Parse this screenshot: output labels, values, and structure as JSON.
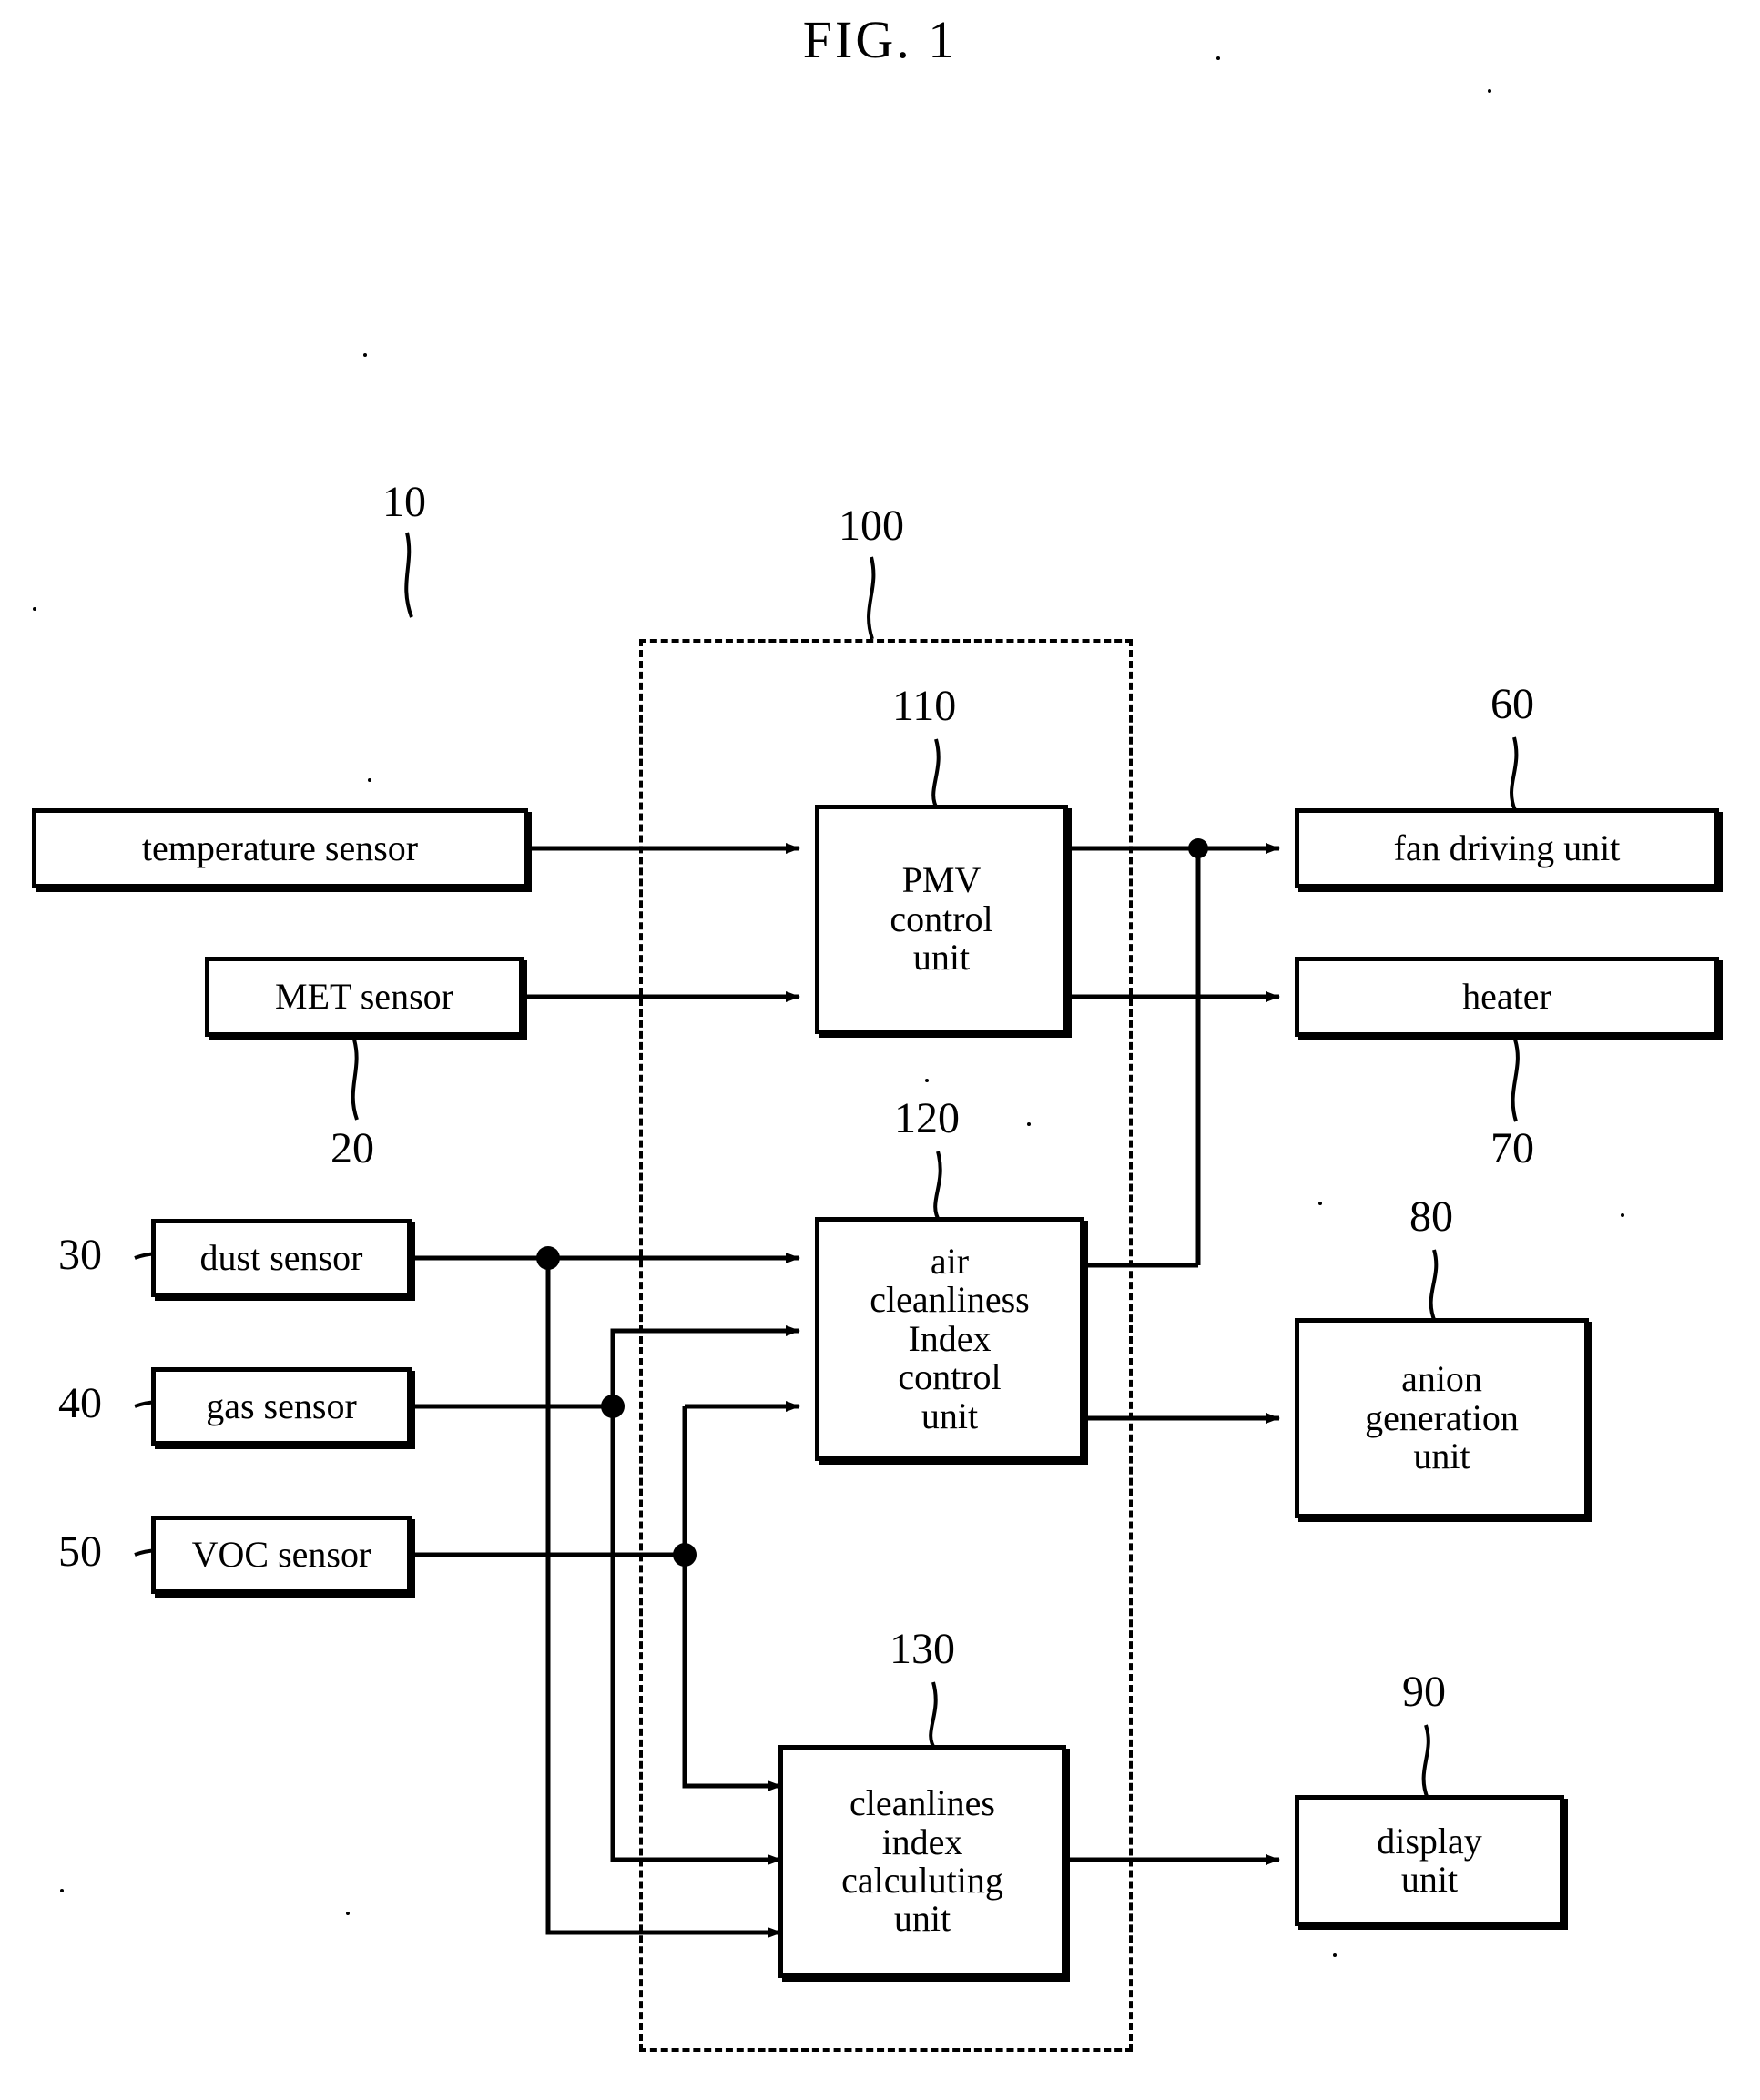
{
  "figure": {
    "title": "FIG. 1",
    "type": "patent-block-diagram"
  },
  "boxes": [
    {
      "id": "temperature-sensor",
      "label": "temperature sensor",
      "ref": "10"
    },
    {
      "id": "met-sensor",
      "label": "MET sensor",
      "ref": "20"
    },
    {
      "id": "dust-sensor",
      "label": "dust sensor",
      "ref": "30"
    },
    {
      "id": "gas-sensor",
      "label": "gas sensor",
      "ref": "40"
    },
    {
      "id": "voc-sensor",
      "label": "VOC sensor",
      "ref": "50"
    },
    {
      "id": "pmv-control-unit",
      "label": "PMV\ncontrol\nunit",
      "ref": "110"
    },
    {
      "id": "air-cleanliness-index-control-unit",
      "label": "air\ncleanliness\nIndex\ncontrol\nunit",
      "ref": "120"
    },
    {
      "id": "cleanlines-index-calculuting-unit",
      "label": "cleanlines\nindex\ncalculuting\nunit",
      "ref": "130"
    },
    {
      "id": "fan-driving-unit",
      "label": "fan driving unit",
      "ref": "60"
    },
    {
      "id": "heater",
      "label": "heater",
      "ref": "70"
    },
    {
      "id": "anion-generation-unit",
      "label": "anion\ngeneration\nunit",
      "ref": "80"
    },
    {
      "id": "display-unit",
      "label": "display\nunit",
      "ref": "90"
    }
  ],
  "controller": {
    "ref": "100",
    "name": "controller enclosure"
  },
  "refs": {
    "r10": "10",
    "r20": "20",
    "r30": "30",
    "r40": "40",
    "r50": "50",
    "r60": "60",
    "r70": "70",
    "r80": "80",
    "r90": "90",
    "r100": "100",
    "r110": "110",
    "r120": "120",
    "r130": "130"
  },
  "labels": {
    "temperature_sensor": "temperature sensor",
    "met_sensor": "MET sensor",
    "dust_sensor": "dust sensor",
    "gas_sensor": "gas sensor",
    "voc_sensor": "VOC sensor",
    "pmv_l1": "PMV",
    "pmv_l2": "control",
    "pmv_l3": "unit",
    "aci_l1": "air",
    "aci_l2": "cleanliness",
    "aci_l3": "Index",
    "aci_l4": "control",
    "aci_l5": "unit",
    "cic_l1": "cleanlines",
    "cic_l2": "index",
    "cic_l3": "calculuting",
    "cic_l4": "unit",
    "fan_driving_unit": "fan driving unit",
    "heater": "heater",
    "anion_l1": "anion",
    "anion_l2": "generation",
    "anion_l3": "unit",
    "display_l1": "display",
    "display_l2": "unit"
  },
  "colors": {
    "ink": "#000000",
    "paper": "#ffffff"
  }
}
